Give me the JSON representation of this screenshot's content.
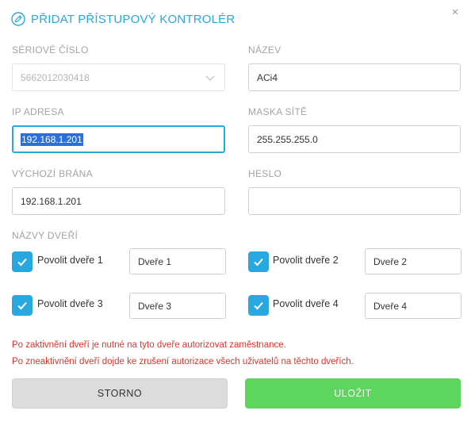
{
  "dialog": {
    "title": "PŘIDAT PŘÍSTUPOVÝ KONTROLÉR",
    "title_icon": "pencil-circle-icon",
    "close_icon": "close-icon",
    "close_label": "×"
  },
  "fields": {
    "serial": {
      "label": "SÉRIOVÉ ČÍSLO",
      "value": "5662012030418",
      "disabled": true
    },
    "name": {
      "label": "NÁZEV",
      "value": "ACi4"
    },
    "ip": {
      "label": "IP ADRESA",
      "value": "192.168.1.201",
      "selected": true
    },
    "mask": {
      "label": "MASKA SÍTĚ",
      "value": "255.255.255.0"
    },
    "gateway": {
      "label": "VÝCHOZÍ BRÁNA",
      "value": "192.168.1.201"
    },
    "password": {
      "label": "HESLO",
      "value": ""
    }
  },
  "doors": {
    "label": "NÁZVY DVEŘÍ",
    "items": [
      {
        "checkbox_label": "Povolit dveře 1",
        "name": "Dveře 1",
        "checked": true
      },
      {
        "checkbox_label": "Povolit dveře 2",
        "name": "Dveře 2",
        "checked": true
      },
      {
        "checkbox_label": "Povolit dveře 3",
        "name": "Dveře 3",
        "checked": true
      },
      {
        "checkbox_label": "Povolit dveře 4",
        "name": "Dveře 4",
        "checked": true
      }
    ]
  },
  "notes": [
    "Po zaktivnění dveří je nutné na tyto dveře autorizovat zaměstnance.",
    "Po zneaktivnění dveří dojde ke zrušení autorizace všech uživatelů na těchto dveřích."
  ],
  "buttons": {
    "cancel": "STORNO",
    "save": "ULOŽIT"
  },
  "colors": {
    "accent": "#29a8e0",
    "save": "#5cd65c",
    "warning": "#e0342b",
    "cancel": "#dcdcdc"
  }
}
